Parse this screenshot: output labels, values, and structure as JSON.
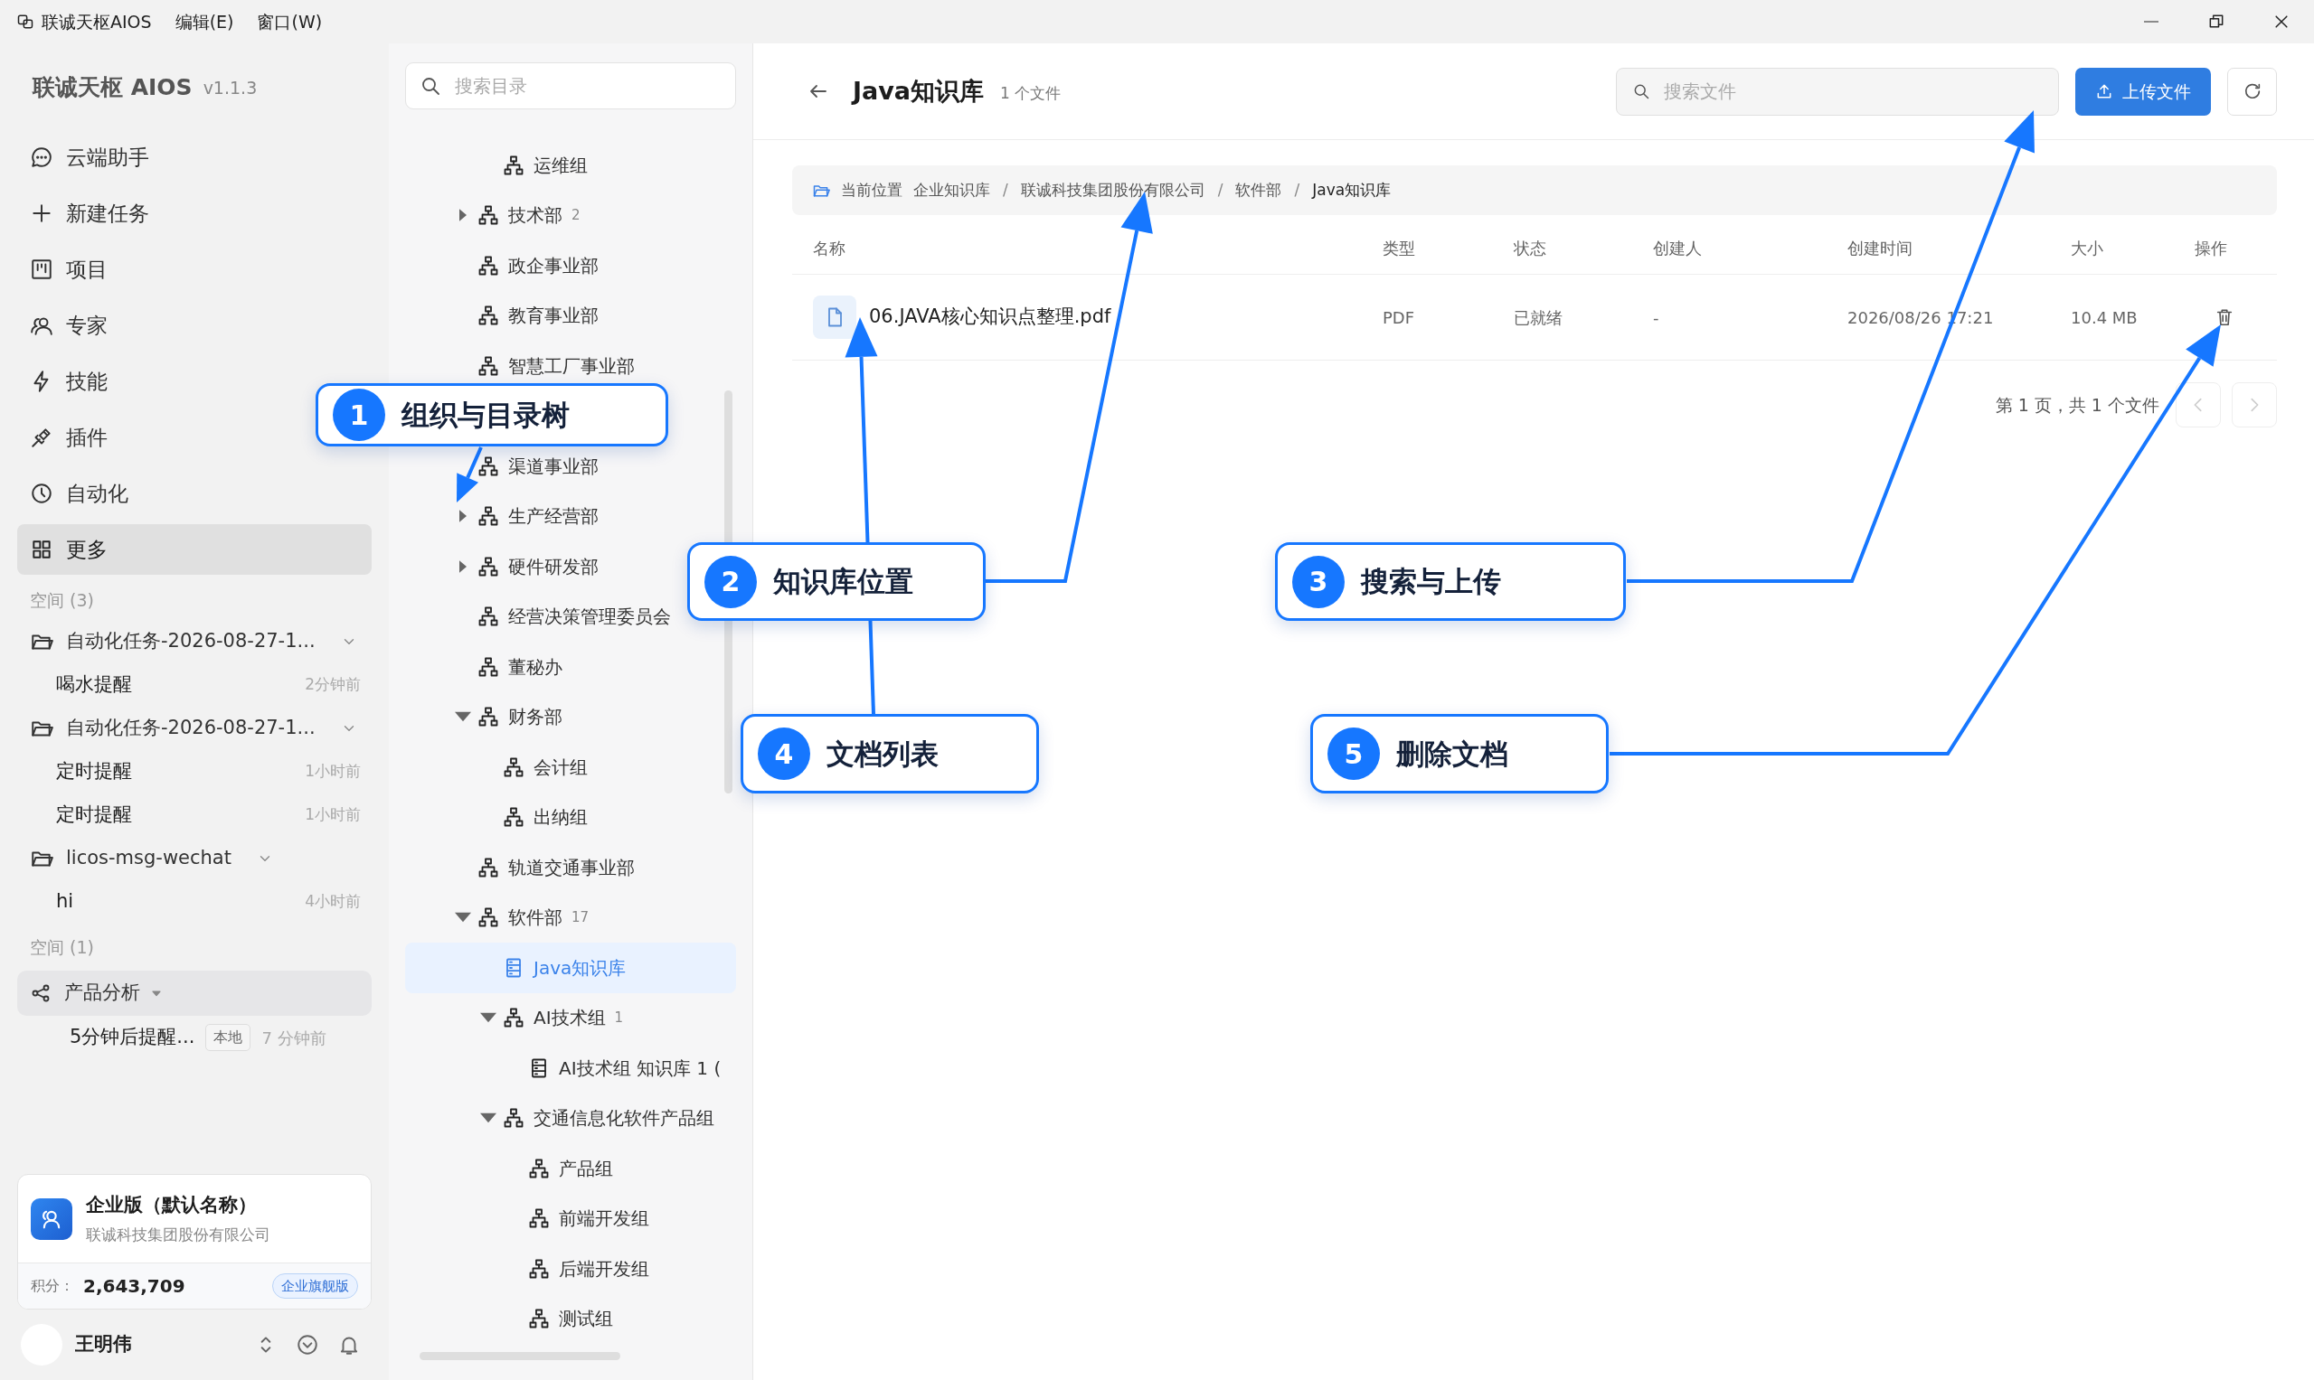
{
  "titlebar": {
    "menu": [
      {
        "label": "联诚天枢AIOS",
        "kind": "app"
      },
      {
        "label": "编辑(E)",
        "kind": "menu"
      },
      {
        "label": "窗口(W)",
        "kind": "menu"
      }
    ]
  },
  "sidebar": {
    "brand": "联诚天枢 AIOS",
    "version": "v1.1.3",
    "nav": [
      {
        "label": "云端助手",
        "selected": false
      },
      {
        "label": "新建任务",
        "selected": false
      },
      {
        "label": "项目",
        "selected": false
      },
      {
        "label": "专家",
        "selected": false
      },
      {
        "label": "技能",
        "selected": false
      },
      {
        "label": "插件",
        "selected": false
      },
      {
        "label": "自动化",
        "selected": false
      },
      {
        "label": "更多",
        "selected": true
      }
    ],
    "spaces": [
      {
        "heading": "空间 (3)",
        "groups": [
          {
            "kind": "folder",
            "label": "自动化任务-2026-08-27-1...",
            "selected": false,
            "items": [
              {
                "label": "喝水提醒",
                "time": "2分钟前"
              }
            ]
          },
          {
            "kind": "folder",
            "label": "自动化任务-2026-08-27-1...",
            "selected": false,
            "items": [
              {
                "label": "定时提醒",
                "time": "1小时前"
              },
              {
                "label": "定时提醒",
                "time": "1小时前"
              }
            ]
          },
          {
            "kind": "folder",
            "label": "licos-msg-wechat",
            "selected": false,
            "items": [
              {
                "label": "hi",
                "time": "4小时前"
              }
            ]
          }
        ]
      },
      {
        "heading": "空间 (1)",
        "groups": [
          {
            "kind": "shared",
            "label": "产品分析",
            "selected": true,
            "items": [
              {
                "label": "5分钟后提醒...",
                "tag": "本地",
                "time": "7 分钟前"
              }
            ]
          }
        ]
      }
    ],
    "enterprise": {
      "name": "企业版（默认名称）",
      "company": "联诚科技集团股份有限公司",
      "points_label": "积分：",
      "points": "2,643,709",
      "plan": "企业旗舰版"
    },
    "user": {
      "name": "王明伟"
    }
  },
  "tree": {
    "search_placeholder": "搜索目录",
    "leading": [
      {
        "label": "运维组",
        "kind": "org",
        "selected": false
      }
    ],
    "items": [
      {
        "label": "技术部",
        "count": "2",
        "kind": "org",
        "expanded": false,
        "selected": false
      },
      {
        "label": "政企事业部",
        "kind": "org",
        "selected": false
      },
      {
        "label": "教育事业部",
        "kind": "org",
        "selected": false
      },
      {
        "label": "智慧工厂事业部",
        "kind": "org",
        "selected": false
      },
      {
        "label": "渠道事业部",
        "kind": "org",
        "selected": false
      },
      {
        "label": "生产经营部",
        "kind": "org",
        "expanded": false,
        "selected": false
      },
      {
        "label": "硬件研发部",
        "kind": "org",
        "expanded": false,
        "selected": false
      },
      {
        "label": "经营决策管理委员会",
        "kind": "org",
        "selected": false
      },
      {
        "label": "董秘办",
        "kind": "org",
        "selected": false
      },
      {
        "label": "财务部",
        "kind": "org",
        "expanded": true,
        "selected": false,
        "children": [
          {
            "label": "会计组",
            "kind": "org",
            "selected": false
          },
          {
            "label": "出纳组",
            "kind": "org",
            "selected": false
          }
        ]
      },
      {
        "label": "轨道交通事业部",
        "kind": "org",
        "selected": false
      },
      {
        "label": "软件部",
        "count": "17",
        "kind": "org",
        "expanded": true,
        "selected": false,
        "children": [
          {
            "label": "Java知识库",
            "kind": "kb",
            "selected": true
          },
          {
            "label": "AI技术组",
            "count": "1",
            "kind": "org",
            "expanded": true,
            "selected": false,
            "children": [
              {
                "label": "AI技术组 知识库 1 (",
                "kind": "kb",
                "selected": false
              }
            ]
          },
          {
            "label": "交通信息化软件产品组",
            "kind": "org",
            "expanded": true,
            "selected": false,
            "children": [
              {
                "label": "产品组",
                "kind": "org",
                "selected": false
              },
              {
                "label": "前端开发组",
                "kind": "org",
                "selected": false
              },
              {
                "label": "后端开发组",
                "kind": "org",
                "selected": false
              },
              {
                "label": "测试组",
                "kind": "org",
                "selected": false
              }
            ]
          }
        ]
      }
    ]
  },
  "main": {
    "title": "Java知识库",
    "count": "1 个文件",
    "search_placeholder": "搜索文件",
    "upload": "上传文件",
    "breadcrumb": [
      {
        "kind": "label",
        "text": "当前位置"
      },
      {
        "kind": "crumb",
        "text": "企业知识库"
      },
      {
        "kind": "separator",
        "text": "/"
      },
      {
        "kind": "crumb",
        "text": "联诚科技集团股份有限公司"
      },
      {
        "kind": "separator",
        "text": "/"
      },
      {
        "kind": "crumb",
        "text": "软件部"
      },
      {
        "kind": "separator",
        "text": "/"
      },
      {
        "kind": "current",
        "text": "Java知识库"
      }
    ],
    "table": {
      "columns": [
        "名称",
        "类型",
        "状态",
        "创建人",
        "创建时间",
        "大小",
        "操作"
      ],
      "rows": [
        {
          "cells": [
            "06.JAVA核心知识点整理.pdf",
            "PDF",
            "已就绪",
            "-",
            "2026/08/26 17:21",
            "10.4 MB"
          ]
        }
      ]
    },
    "pagination": {
      "summary": "第 1 页，共 1 个文件",
      "prev_disabled": true,
      "next_disabled": true
    }
  },
  "callouts": [
    {
      "number": "1",
      "label": "组织与目录树"
    },
    {
      "number": "2",
      "label": "知识库位置"
    },
    {
      "number": "3",
      "label": "搜索与上传"
    },
    {
      "number": "4",
      "label": "文档列表"
    },
    {
      "number": "5",
      "label": "删除文档"
    }
  ]
}
